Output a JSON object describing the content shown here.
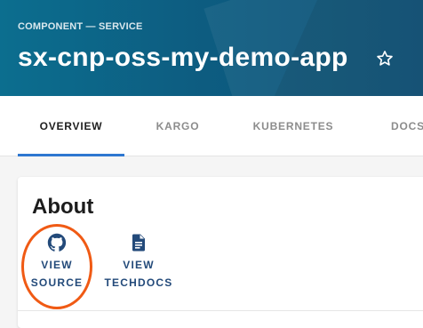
{
  "header": {
    "breadcrumb": "COMPONENT — SERVICE",
    "title": "sx-cnp-oss-my-demo-app",
    "favorite_icon": "star-outline-icon"
  },
  "tabs": [
    {
      "label": "OVERVIEW",
      "active": true
    },
    {
      "label": "KARGO",
      "active": false
    },
    {
      "label": "KUBERNETES",
      "active": false
    },
    {
      "label": "DOCS",
      "active": false
    }
  ],
  "about": {
    "title": "About",
    "links": [
      {
        "icon": "github-icon",
        "line1": "VIEW",
        "line2": "SOURCE"
      },
      {
        "icon": "document-icon",
        "line1": "VIEW",
        "line2": "TECHDOCS"
      }
    ]
  },
  "colors": {
    "header_start": "#0c6e8f",
    "header_end": "#0a4f76",
    "tab_indicator": "#2e77d0",
    "link_color": "#234a7a",
    "annotation_circle": "#f05a14"
  }
}
